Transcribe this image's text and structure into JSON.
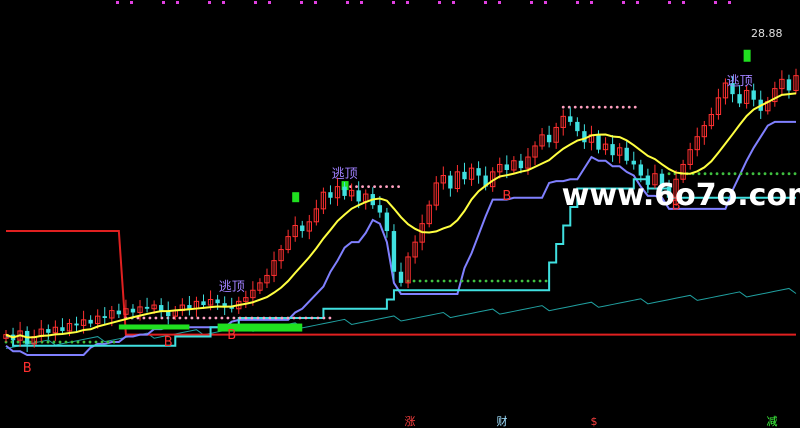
{
  "chart_data": {
    "type": "candlestick",
    "background": "#000000",
    "price_label": "28.88",
    "signals": {
      "buy_label": "B",
      "buy_indices": [
        3,
        23,
        32,
        71,
        95
      ],
      "top_label": "逃顶",
      "top_indices": [
        32,
        48,
        104
      ]
    },
    "bottom_labels": [
      {
        "text": "涨",
        "color": "#ff4040"
      },
      {
        "text": "财",
        "color": "#a0e0ff"
      },
      {
        "text": "$",
        "color": "#ff4040"
      },
      {
        "text": "减",
        "color": "#40ff40"
      }
    ],
    "watermark": "www.6o7o.com",
    "colors": {
      "up": "#ff3030",
      "down": "#40e0e0",
      "ma": "#ffff40",
      "band": "#8080ff",
      "step": "#40e0e0",
      "red_line": "#e02020",
      "dots_green": "#40c040",
      "dots_pink": "#ffa0c0"
    },
    "close": [
      12.6,
      12.3,
      12.8,
      12.1,
      12.5,
      12.9,
      12.7,
      13.0,
      12.8,
      13.2,
      13.1,
      13.4,
      13.2,
      13.6,
      13.5,
      13.9,
      13.7,
      14.0,
      13.8,
      14.1,
      14.0,
      14.2,
      13.9,
      13.6,
      13.9,
      14.2,
      14.0,
      14.4,
      14.2,
      14.5,
      14.3,
      14.1,
      14.0,
      14.4,
      14.6,
      15.0,
      15.4,
      15.8,
      16.6,
      17.2,
      17.9,
      18.5,
      18.2,
      18.7,
      19.4,
      20.3,
      20.0,
      20.6,
      20.1,
      20.4,
      19.8,
      20.2,
      19.6,
      19.2,
      18.2,
      16.0,
      15.4,
      16.8,
      17.6,
      18.6,
      19.6,
      20.8,
      21.2,
      20.5,
      21.4,
      21.0,
      21.6,
      21.2,
      20.6,
      21.4,
      21.8,
      21.5,
      22.0,
      21.6,
      22.2,
      22.8,
      23.4,
      23.0,
      23.8,
      24.4,
      24.1,
      23.6,
      23.0,
      23.4,
      22.6,
      22.9,
      22.3,
      22.7,
      22.0,
      21.8,
      21.2,
      20.7,
      21.3,
      20.6,
      20.0,
      21.0,
      21.8,
      22.6,
      23.3,
      23.9,
      24.5,
      25.4,
      26.2,
      25.6,
      25.1,
      25.8,
      25.3,
      24.7,
      25.2,
      25.9,
      26.4,
      25.8,
      26.6
    ]
  }
}
